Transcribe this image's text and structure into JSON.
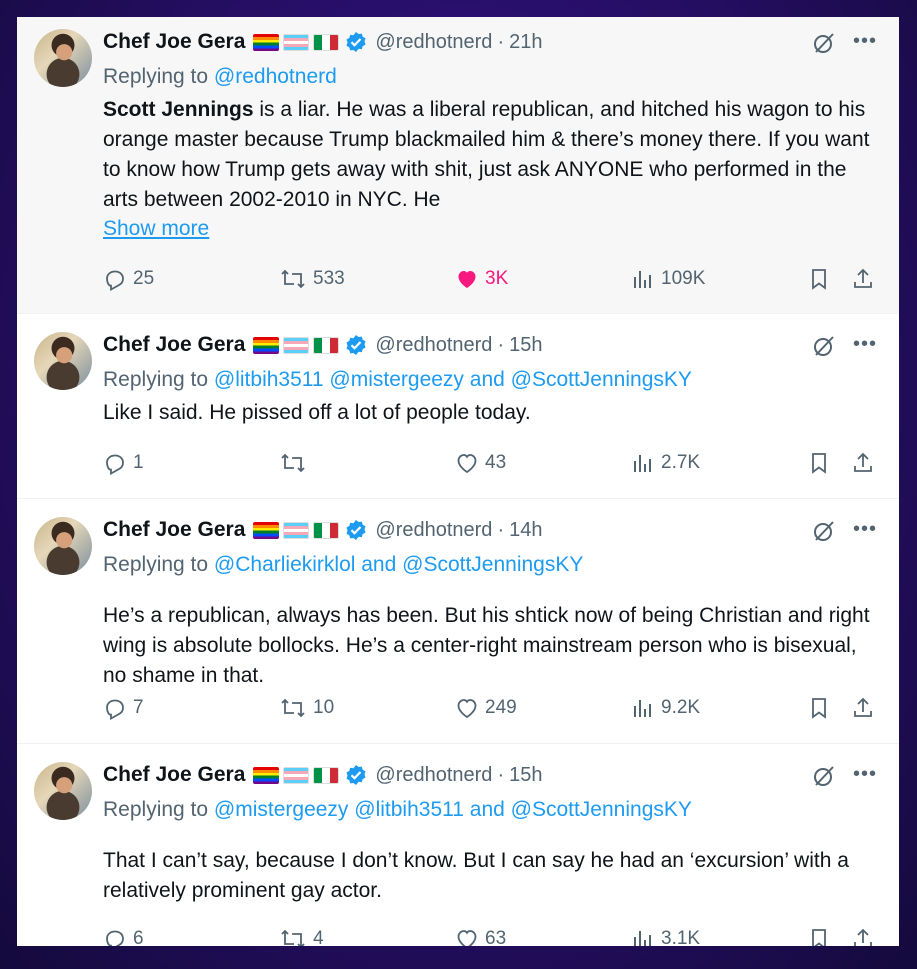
{
  "tweets": [
    {
      "name": "Chef Joe Gera",
      "handle": "@redhotnerd",
      "time": "21h",
      "replying_prefix": "Replying to",
      "replying_to": "@redhotnerd",
      "body_bold": "Scott Jennings",
      "body": " is a liar. He was a liberal republican, and hitched his wagon to his orange master because Trump blackmailed him & there’s money there. If you want to know how Trump gets away with shit, just ask ANYONE who performed in the arts between 2002-2010 in NYC. He",
      "show_more": "Show more",
      "replies": "25",
      "reposts": "533",
      "likes": "3K",
      "views": "109K",
      "liked": true
    },
    {
      "name": "Chef Joe Gera",
      "handle": "@redhotnerd",
      "time": "15h",
      "replying_prefix": "Replying to",
      "replying_to": "@litbih3511 @mistergeezy and @ScottJenningsKY",
      "body": "Like  I said. He pissed off a lot of people today.",
      "replies": "1",
      "reposts": "",
      "likes": "43",
      "views": "2.7K",
      "liked": false
    },
    {
      "name": "Chef Joe Gera",
      "handle": "@redhotnerd",
      "time": "14h",
      "replying_prefix": "Replying to",
      "replying_to": "@Charliekirklol and @ScottJenningsKY",
      "body": "He’s a republican, always has been. But his shtick now of being Christian and right wing is absolute bollocks. He’s a center-right mainstream person who is bisexual, no shame in that.",
      "replies": "7",
      "reposts": "10",
      "likes": "249",
      "views": "9.2K",
      "liked": false
    },
    {
      "name": "Chef Joe Gera",
      "handle": "@redhotnerd",
      "time": "15h",
      "replying_prefix": "Replying to",
      "replying_to": "@mistergeezy @litbih3511 and @ScottJenningsKY",
      "body": "That I can’t say, because I don’t know. But I can say he had an ‘excursion’ with a relatively prominent gay actor.",
      "replies": "6",
      "reposts": "4",
      "likes": "63",
      "views": "3.1K",
      "liked": false
    }
  ],
  "dot": "·",
  "colors": {
    "link": "#1d9bf0",
    "like": "#f91880",
    "muted": "#536471",
    "verified": "#1d9bf0"
  },
  "icons": [
    "verified-badge-icon",
    "grok-icon",
    "more-icon",
    "reply-icon",
    "repost-icon",
    "like-icon",
    "views-icon",
    "bookmark-icon",
    "share-icon"
  ]
}
